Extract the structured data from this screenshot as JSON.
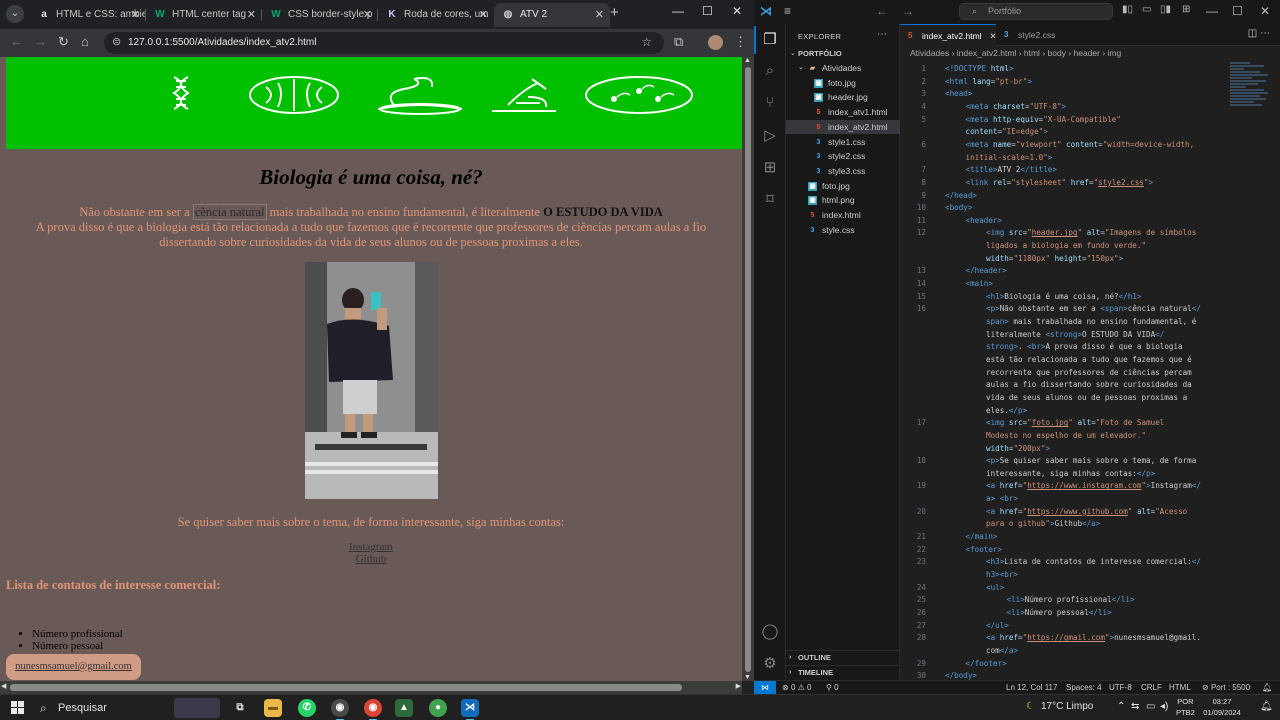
{
  "browser": {
    "tabs": [
      {
        "label": "HTML e CSS: ambie",
        "icon": "alura-icon",
        "icon_glyph": "a",
        "icon_color": "#e8e8e8"
      },
      {
        "label": "HTML center tag",
        "icon": "w3schools-icon",
        "icon_glyph": "W",
        "icon_color": "#04aa6d"
      },
      {
        "label": "CSS border-style p",
        "icon": "w3schools-icon",
        "icon_glyph": "W",
        "icon_color": "#04aa6d"
      },
      {
        "label": "Roda de cores, um",
        "icon": "color-wheel-icon",
        "icon_glyph": "K",
        "icon_color": "#c8c8ff"
      },
      {
        "label": "ATV 2",
        "icon": "globe-icon",
        "icon_glyph": "◍",
        "icon_color": "#c8c8c8"
      }
    ],
    "url": "127.0.0.1:5500/Atividades/index_atv2.html"
  },
  "page": {
    "title": "Biologia é uma coisa, né?",
    "intro_before": "Não obstante em ser a ",
    "intro_span": "cência natural",
    "intro_middle": " mais trabalhada no ensino fundamental, é literalmente ",
    "intro_strong": "O ESTUDO DA VIDA",
    "intro_after": "A prova disso é que a biologia está tão relacionada a tudo que fazemos que é recorrente que professores de ciências percam aulas a fio dissertando sobre curiosidades da vida de seus alunos ou de pessoas proximas a eles.",
    "follow_text": "Se quiser saber mais sobre o tema, de forma interessante, siga minhas contas:",
    "link_instagram": "Instagram",
    "link_github": "Github",
    "contacts_heading": "Lista de contatos de interesse comercial:",
    "contacts": [
      "Número profissional",
      "Número pessoal"
    ],
    "email": "nunesmsamuel@gmail.com",
    "header_bg": "#00c000",
    "body_bg": "#6a5a57",
    "text_color": "#e09475"
  },
  "vscode": {
    "search_placeholder": "Portfólio",
    "explorer_title": "EXPLORER",
    "root": "PORTFÓLIO",
    "tree": [
      {
        "name": "Atividades",
        "type": "folder",
        "depth": 1
      },
      {
        "name": "foto.jpg",
        "type": "img",
        "depth": 2
      },
      {
        "name": "header.jpg",
        "type": "img",
        "depth": 2
      },
      {
        "name": "index_atv1.html",
        "type": "html",
        "depth": 2
      },
      {
        "name": "index_atv2.html",
        "type": "html",
        "depth": 2,
        "selected": true
      },
      {
        "name": "style1.css",
        "type": "css",
        "depth": 2
      },
      {
        "name": "style2.css",
        "type": "css",
        "depth": 2
      },
      {
        "name": "style3.css",
        "type": "css",
        "depth": 2
      },
      {
        "name": "foto.jpg",
        "type": "img",
        "depth": 1
      },
      {
        "name": "html.png",
        "type": "img",
        "depth": 1
      },
      {
        "name": "index.html",
        "type": "html",
        "depth": 1
      },
      {
        "name": "style.css",
        "type": "css",
        "depth": 1
      }
    ],
    "outline": "OUTLINE",
    "timeline": "TIMELINE",
    "editor_tabs": [
      {
        "name": "index_atv2.html",
        "type": "html",
        "active": true
      },
      {
        "name": "style2.css",
        "type": "css",
        "active": false
      }
    ],
    "breadcrumb": [
      "Atividades",
      "index_atv2.html",
      "html",
      "body",
      "header",
      "img"
    ],
    "code": [
      {
        "n": "1",
        "ind": 0,
        "h": "<span class='tg'>&lt;!DOCTYPE</span> <span class='at'>html</span><span class='tg'>&gt;</span>"
      },
      {
        "n": "2",
        "ind": 0,
        "h": "<span class='tg'>&lt;html</span> <span class='at'>lang</span>=<span class='st'>\"pt-br\"</span><span class='tg'>&gt;</span>"
      },
      {
        "n": "3",
        "ind": 0,
        "h": "<span class='tg'>&lt;head&gt;</span>"
      },
      {
        "n": "4",
        "ind": 1,
        "h": "<span class='tg'>&lt;meta</span> <span class='at'>charset</span>=<span class='st'>\"UTF-8\"</span><span class='tg'>&gt;</span>"
      },
      {
        "n": "5",
        "ind": 1,
        "h": "<span class='tg'>&lt;meta</span> <span class='at'>http-equiv</span>=<span class='st'>\"X-UA-Compatible\"</span>"
      },
      {
        "n": "",
        "ind": 1,
        "h": "<span class='at'>content</span>=<span class='st'>\"IE=edge\"</span><span class='tg'>&gt;</span>"
      },
      {
        "n": "6",
        "ind": 1,
        "h": "<span class='tg'>&lt;meta</span> <span class='at'>name</span>=<span class='st'>\"viewport\"</span> <span class='at'>content</span>=<span class='st'>\"width=device-width,</span>"
      },
      {
        "n": "",
        "ind": 1,
        "h": "<span class='st'>initial-scale=1.0\"</span><span class='tg'>&gt;</span>"
      },
      {
        "n": "7",
        "ind": 1,
        "h": "<span class='tg'>&lt;title&gt;</span>ATV 2<span class='tg'>&lt;/title&gt;</span>"
      },
      {
        "n": "8",
        "ind": 1,
        "h": "<span class='tg'>&lt;link</span> <span class='at'>rel</span>=<span class='st'>\"stylesheet\"</span> <span class='at'>href</span>=<span class='st'>\"<u>style2.css</u>\"</span><span class='tg'>&gt;</span>"
      },
      {
        "n": "9",
        "ind": 0,
        "h": "<span class='tg'>&lt;/head&gt;</span>"
      },
      {
        "n": "10",
        "ind": 0,
        "h": "<span class='tg'>&lt;body&gt;</span>"
      },
      {
        "n": "11",
        "ind": 1,
        "h": "<span class='tg'>&lt;header&gt;</span>"
      },
      {
        "n": "12",
        "ind": 2,
        "h": "<span class='tg'>&lt;img</span> <span class='at'>src</span>=<span class='st'>\"<u>header.jpg</u>\"</span> <span class='at'>alt</span>=<span class='st'>\"Imagens de símbolos</span>"
      },
      {
        "n": "",
        "ind": 2,
        "h": "<span class='st'>ligados a biologia em fundo verde.\"</span>"
      },
      {
        "n": "",
        "ind": 2,
        "h": "<span class='at'>width</span>=<span class='st'>\"1180px\"</span> <span class='at'>height</span>=<span class='st'>\"150px\"</span><span class='tg'>&gt;</span>"
      },
      {
        "n": "13",
        "ind": 1,
        "h": "<span class='tg'>&lt;/header&gt;</span>"
      },
      {
        "n": "14",
        "ind": 1,
        "h": "<span class='tg'>&lt;main&gt;</span>"
      },
      {
        "n": "15",
        "ind": 2,
        "h": "<span class='tg'>&lt;h1&gt;</span>Biologia é uma coisa, né?<span class='tg'>&lt;/h1&gt;</span>"
      },
      {
        "n": "16",
        "ind": 2,
        "h": "<span class='tg'>&lt;p&gt;</span>Não obstante em ser a <span class='tg'>&lt;span&gt;</span>cência natural<span class='tg'>&lt;/</span>"
      },
      {
        "n": "",
        "ind": 2,
        "h": "<span class='tg'>span&gt;</span> mais trabalhada no ensino fundamental, é"
      },
      {
        "n": "",
        "ind": 2,
        "h": "literalmente <span class='tg'>&lt;strong&gt;</span>O ESTUDO DA VIDA<span class='tg'>&lt;/</span>"
      },
      {
        "n": "",
        "ind": 2,
        "h": "<span class='tg'>strong&gt;</span>. <span class='tg'>&lt;br&gt;</span>A prova disso é que a biologia"
      },
      {
        "n": "",
        "ind": 2,
        "h": "está tão relacionada a tudo que fazemos que é"
      },
      {
        "n": "",
        "ind": 2,
        "h": "recorrente que professores de ciências percam"
      },
      {
        "n": "",
        "ind": 2,
        "h": "aulas a fio dissertando sobre curiosidades da"
      },
      {
        "n": "",
        "ind": 2,
        "h": "vida de seus alunos ou de pessoas proximas a"
      },
      {
        "n": "",
        "ind": 2,
        "h": "eles.<span class='tg'>&lt;/p&gt;</span>"
      },
      {
        "n": "17",
        "ind": 2,
        "h": "<span class='tg'>&lt;img</span> <span class='at'>src</span>=<span class='st'>\"<u>foto.jpg</u>\"</span> <span class='at'>alt</span>=<span class='st'>\"Foto de Samuel</span>"
      },
      {
        "n": "",
        "ind": 2,
        "h": "<span class='st'>Modesto no espelho de um elevador.\"</span>"
      },
      {
        "n": "",
        "ind": 2,
        "h": "<span class='at'>width</span>=<span class='st'>\"200px\"</span><span class='tg'>&gt;</span>"
      },
      {
        "n": "18",
        "ind": 2,
        "h": "<span class='tg'>&lt;p&gt;</span>Se quiser saber mais sobre o tema, de forma"
      },
      {
        "n": "",
        "ind": 2,
        "h": "interessante, siga minhas contas:<span class='tg'>&lt;/p&gt;</span>"
      },
      {
        "n": "19",
        "ind": 2,
        "h": "<span class='tg'>&lt;a</span> <span class='at'>href</span>=<span class='st'>\"<u>https://www.instagram.com</u>\"</span><span class='tg'>&gt;</span>Instagram<span class='tg'>&lt;/</span>"
      },
      {
        "n": "",
        "ind": 2,
        "h": "<span class='tg'>a&gt;</span> <span class='tg'>&lt;br&gt;</span>"
      },
      {
        "n": "20",
        "ind": 2,
        "h": "<span class='tg'>&lt;a</span> <span class='at'>href</span>=<span class='st'>\"<u>https://www.github.com</u>\"</span> <span class='at'>alt</span>=<span class='st'>\"Acesso</span>"
      },
      {
        "n": "",
        "ind": 2,
        "h": "<span class='st'>para o github\"</span><span class='tg'>&gt;</span>Github<span class='tg'>&lt;/a&gt;</span>"
      },
      {
        "n": "21",
        "ind": 1,
        "h": "<span class='tg'>&lt;/main&gt;</span>"
      },
      {
        "n": "22",
        "ind": 1,
        "h": "<span class='tg'>&lt;footer&gt;</span>"
      },
      {
        "n": "23",
        "ind": 2,
        "h": "<span class='tg'>&lt;h3&gt;</span>Lista de contatos de interesse comercial:<span class='tg'>&lt;/</span>"
      },
      {
        "n": "",
        "ind": 2,
        "h": "<span class='tg'>h3&gt;&lt;br&gt;</span>"
      },
      {
        "n": "24",
        "ind": 2,
        "h": "<span class='tg'>&lt;ul&gt;</span>"
      },
      {
        "n": "25",
        "ind": 3,
        "h": "<span class='tg'>&lt;li&gt;</span>Número profissional<span class='tg'>&lt;/li&gt;</span>"
      },
      {
        "n": "26",
        "ind": 3,
        "h": "<span class='tg'>&lt;li&gt;</span>Número pessoal<span class='tg'>&lt;/li&gt;</span>"
      },
      {
        "n": "27",
        "ind": 2,
        "h": "<span class='tg'>&lt;/ul&gt;</span>"
      },
      {
        "n": "28",
        "ind": 2,
        "h": "<span class='tg'>&lt;a</span> <span class='at'>href</span>=<span class='st'>\"<u>https://gmail.com</u>\"</span><span class='tg'>&gt;</span>nunesmsamuel@gmail."
      },
      {
        "n": "",
        "ind": 2,
        "h": "com<span class='tg'>&lt;/a&gt;</span>"
      },
      {
        "n": "29",
        "ind": 1,
        "h": "<span class='tg'>&lt;/footer&gt;</span>"
      },
      {
        "n": "30",
        "ind": 0,
        "h": "<span class='tg'>&lt;/body&gt;</span>"
      }
    ],
    "status": {
      "errors": "0",
      "warnings": "0",
      "ports": "0",
      "position": "Ln 12, Col 117",
      "spaces": "Spaces: 4",
      "encoding": "UTF-8",
      "eol": "CRLF",
      "language": "HTML",
      "port": "Port : 5500"
    }
  },
  "taskbar": {
    "search": "Pesquisar",
    "weather_temp": "17°C",
    "weather_desc": "Limpo",
    "lang_1": "POR",
    "lang_2": "PTB2",
    "time": "03:27",
    "date": "01/09/2024"
  }
}
